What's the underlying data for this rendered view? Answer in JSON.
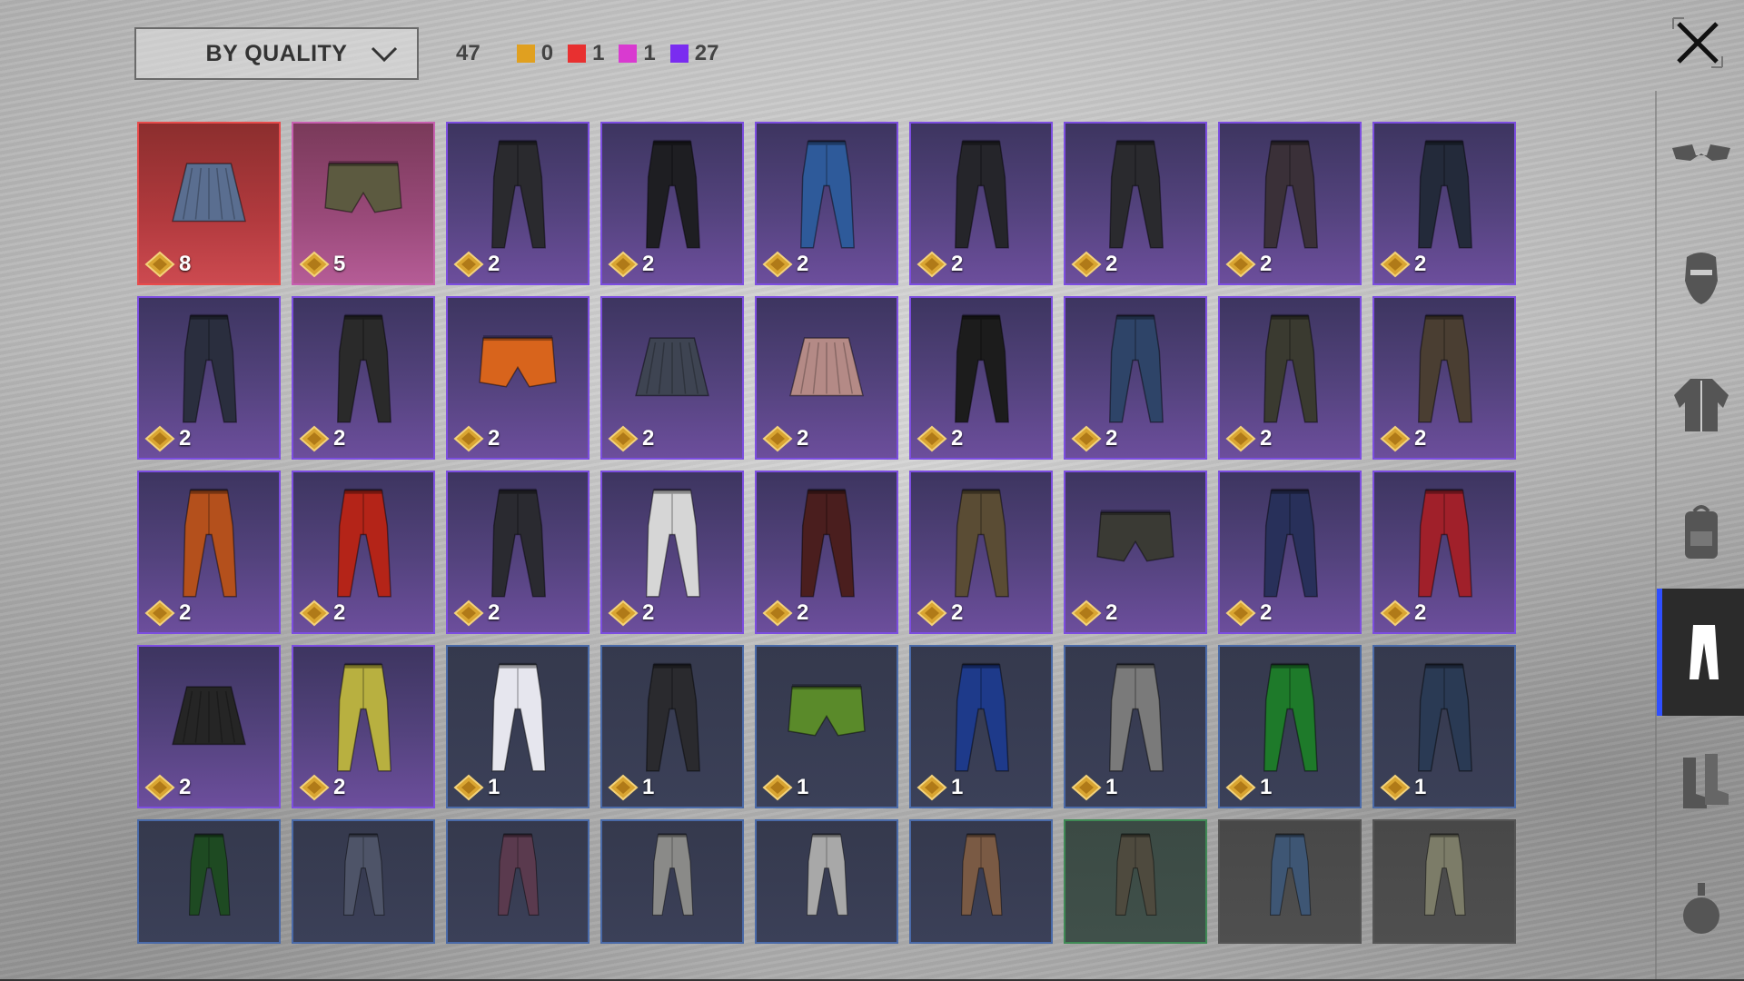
{
  "toolbar": {
    "sort_label": "BY QUALITY",
    "total_count": "47",
    "quality_counts": [
      {
        "color": "#e0a020",
        "count": "0"
      },
      {
        "color": "#e83030",
        "count": "1"
      },
      {
        "color": "#d93ad0",
        "count": "1"
      },
      {
        "color": "#7a2cf0",
        "count": "27"
      }
    ]
  },
  "sidebar": {
    "items": [
      {
        "icon": "goggles-icon",
        "active": false
      },
      {
        "icon": "mask-icon",
        "active": false
      },
      {
        "icon": "jacket-icon",
        "active": false
      },
      {
        "icon": "backpack-icon",
        "active": false
      },
      {
        "icon": "pants-icon",
        "active": true
      },
      {
        "icon": "boots-icon",
        "active": false
      },
      {
        "icon": "grenade-icon",
        "active": false
      }
    ]
  },
  "items": [
    {
      "type": "skirt",
      "rarity": "legendary",
      "color": "#5a6e90",
      "count": "8"
    },
    {
      "type": "shorts",
      "rarity": "mythic",
      "color": "#5c5a40",
      "count": "5"
    },
    {
      "type": "pants",
      "rarity": "epic",
      "color": "#2a2a2e",
      "count": "2"
    },
    {
      "type": "pants",
      "rarity": "epic",
      "color": "#1e1e22",
      "count": "2"
    },
    {
      "type": "pants",
      "rarity": "epic",
      "color": "#2e5a9a",
      "count": "2"
    },
    {
      "type": "pants",
      "rarity": "epic",
      "color": "#25252a",
      "count": "2"
    },
    {
      "type": "pants",
      "rarity": "epic",
      "color": "#2a2a2e",
      "count": "2"
    },
    {
      "type": "pants",
      "rarity": "epic",
      "color": "#3a3038",
      "count": "2"
    },
    {
      "type": "pants",
      "rarity": "epic",
      "color": "#232a3a",
      "count": "2"
    },
    {
      "type": "pants",
      "rarity": "epic",
      "color": "#2a2e3e",
      "count": "2"
    },
    {
      "type": "pants",
      "rarity": "epic",
      "color": "#2a2a2a",
      "count": "2"
    },
    {
      "type": "shorts",
      "rarity": "epic",
      "color": "#d8641c",
      "count": "2"
    },
    {
      "type": "skirt",
      "rarity": "epic",
      "color": "#3e4452",
      "count": "2"
    },
    {
      "type": "skirt",
      "rarity": "epic",
      "color": "#b48a86",
      "count": "2"
    },
    {
      "type": "pants",
      "rarity": "epic",
      "color": "#1c1c1c",
      "count": "2"
    },
    {
      "type": "pants",
      "rarity": "epic",
      "color": "#2e4468",
      "count": "2"
    },
    {
      "type": "pants",
      "rarity": "epic",
      "color": "#3a3a30",
      "count": "2"
    },
    {
      "type": "pants",
      "rarity": "epic",
      "color": "#4a3e32",
      "count": "2"
    },
    {
      "type": "pants",
      "rarity": "epic",
      "color": "#b4501c",
      "count": "2"
    },
    {
      "type": "pants",
      "rarity": "epic",
      "color": "#b42418",
      "count": "2"
    },
    {
      "type": "pants",
      "rarity": "epic",
      "color": "#2a2a30",
      "count": "2"
    },
    {
      "type": "pants",
      "rarity": "epic",
      "color": "#d6d6d6",
      "count": "2"
    },
    {
      "type": "pants",
      "rarity": "epic",
      "color": "#4a1e1e",
      "count": "2"
    },
    {
      "type": "pants",
      "rarity": "epic",
      "color": "#5a4c34",
      "count": "2"
    },
    {
      "type": "shorts",
      "rarity": "epic",
      "color": "#3a3a34",
      "count": "2"
    },
    {
      "type": "pants",
      "rarity": "epic",
      "color": "#28305a",
      "count": "2"
    },
    {
      "type": "pants",
      "rarity": "epic",
      "color": "#a0202a",
      "count": "2"
    },
    {
      "type": "skirt",
      "rarity": "epic",
      "color": "#252525",
      "count": "2"
    },
    {
      "type": "pants",
      "rarity": "epic",
      "color": "#b8b040",
      "count": "2"
    },
    {
      "type": "pants",
      "rarity": "rare",
      "color": "#e6e6ee",
      "count": "1"
    },
    {
      "type": "pants",
      "rarity": "rare",
      "color": "#2a2a2e",
      "count": "1"
    },
    {
      "type": "shorts",
      "rarity": "rare",
      "color": "#5a8a2a",
      "count": "1"
    },
    {
      "type": "pants",
      "rarity": "rare",
      "color": "#1e3a8a",
      "count": "1"
    },
    {
      "type": "pants",
      "rarity": "rare",
      "color": "#7a7a7a",
      "count": "1"
    },
    {
      "type": "pants",
      "rarity": "rare",
      "color": "#1e7a2a",
      "count": "1"
    },
    {
      "type": "pants",
      "rarity": "rare",
      "color": "#2a3a54",
      "count": "1"
    },
    {
      "type": "pants",
      "rarity": "rare",
      "color": "#1e4a22",
      "count": ""
    },
    {
      "type": "pants",
      "rarity": "rare",
      "color": "#4e5468",
      "count": ""
    },
    {
      "type": "pants",
      "rarity": "rare",
      "color": "#5a3a4e",
      "count": ""
    },
    {
      "type": "pants",
      "rarity": "rare",
      "color": "#8a8a88",
      "count": ""
    },
    {
      "type": "pants",
      "rarity": "rare",
      "color": "#a8a8a8",
      "count": ""
    },
    {
      "type": "pants",
      "rarity": "rare",
      "color": "#7a5a44",
      "count": ""
    },
    {
      "type": "pants",
      "rarity": "uncommon",
      "color": "#4e4a3e",
      "count": ""
    },
    {
      "type": "pants",
      "rarity": "common",
      "color": "#3e5674",
      "count": ""
    },
    {
      "type": "pants",
      "rarity": "common",
      "color": "#7c7c68",
      "count": ""
    }
  ]
}
